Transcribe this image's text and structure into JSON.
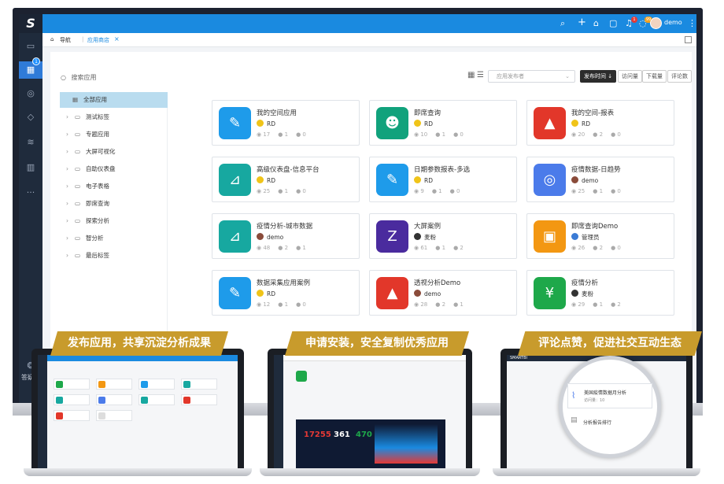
{
  "app": {
    "logo": "S",
    "nav_badge": "1"
  },
  "sidebar": {
    "items": [
      {
        "name": "monitor-icon",
        "glyph": "▭"
      },
      {
        "name": "apps-icon",
        "glyph": "▦"
      },
      {
        "name": "database-icon",
        "glyph": "◎"
      },
      {
        "name": "cube-icon",
        "glyph": "◇"
      },
      {
        "name": "layers-icon",
        "glyph": "≋"
      },
      {
        "name": "chart-icon",
        "glyph": "▥"
      },
      {
        "name": "more-icon",
        "glyph": "···"
      }
    ],
    "bottom_label": "答疑"
  },
  "topbar": {
    "user": "demo",
    "notif_badge": "1",
    "msg_badge": "99"
  },
  "breadcrumb": {
    "home": "导航",
    "current": "应用商店",
    "close": "×"
  },
  "search": {
    "placeholder": "搜索应用"
  },
  "filters": {
    "select_placeholder": "应用发布者",
    "sort_publish": "发布时间 ↓",
    "sort_visits": "访问量",
    "sort_downloads": "下载量",
    "sort_comments": "评论数"
  },
  "tree": {
    "items": [
      {
        "label": "全部应用",
        "selected": true
      },
      {
        "label": "测试标签"
      },
      {
        "label": "专题应用"
      },
      {
        "label": "大屏可视化"
      },
      {
        "label": "自助仪表盘"
      },
      {
        "label": "电子表格"
      },
      {
        "label": "即席查询"
      },
      {
        "label": "探索分析"
      },
      {
        "label": "智分析"
      },
      {
        "label": "最后标签"
      }
    ]
  },
  "cards": [
    {
      "title": "我的空间应用",
      "author": "RD",
      "views": "17",
      "users": "1",
      "comments": "0",
      "color": "#1e9bea",
      "glyph": "✎",
      "avatar": "#f0c419"
    },
    {
      "title": "即席查询",
      "author": "RD",
      "views": "10",
      "users": "1",
      "comments": "0",
      "color": "#11a27c",
      "glyph": "☻",
      "avatar": "#f0c419"
    },
    {
      "title": "我的空间-报表",
      "author": "RD",
      "views": "20",
      "users": "2",
      "comments": "0",
      "color": "#e2372a",
      "glyph": "▲",
      "avatar": "#f0c419"
    },
    {
      "title": "高级仪表盘-信息平台",
      "author": "RD",
      "views": "25",
      "users": "1",
      "comments": "0",
      "color": "#17a8a0",
      "glyph": "⊿",
      "avatar": "#f0c419"
    },
    {
      "title": "日期参数报表-多选",
      "author": "RD",
      "views": "9",
      "users": "1",
      "comments": "0",
      "color": "#1e9bea",
      "glyph": "✎",
      "avatar": "#f0c419"
    },
    {
      "title": "疫情数据-日趋势",
      "author": "demo",
      "views": "25",
      "users": "1",
      "comments": "0",
      "color": "#4b7bea",
      "glyph": "◎",
      "avatar": "#8a4b3a"
    },
    {
      "title": "疫情分析-城市数据",
      "author": "demo",
      "views": "48",
      "users": "2",
      "comments": "1",
      "color": "#17a8a0",
      "glyph": "⊿",
      "avatar": "#8a4b3a"
    },
    {
      "title": "大屏案例",
      "author": "麦粉",
      "views": "61",
      "users": "1",
      "comments": "2",
      "color": "#4a2b9e",
      "glyph": "Z",
      "avatar": "#333"
    },
    {
      "title": "即席查询Demo",
      "author": "管理员",
      "views": "26",
      "users": "2",
      "comments": "0",
      "color": "#f39712",
      "glyph": "▣",
      "avatar": "#3a7bd5"
    },
    {
      "title": "数据采集应用案例",
      "author": "RD",
      "views": "12",
      "users": "1",
      "comments": "0",
      "color": "#1e9bea",
      "glyph": "✎",
      "avatar": "#f0c419"
    },
    {
      "title": "透视分析Demo",
      "author": "demo",
      "views": "28",
      "users": "2",
      "comments": "1",
      "color": "#e2372a",
      "glyph": "▲",
      "avatar": "#8a4b3a"
    },
    {
      "title": "疫情分析",
      "author": "麦粉",
      "views": "29",
      "users": "1",
      "comments": "2",
      "color": "#1ea84a",
      "glyph": "¥",
      "avatar": "#333"
    }
  ],
  "ribbons": [
    "发布应用，共享沉淀分析成果",
    "申请安装，安全复制优秀应用",
    "评论点赞，促进社交互动生态"
  ],
  "mini": {
    "laptop2_numbers": [
      "17255",
      "361",
      "470"
    ],
    "laptop3_logo": "SMARTBI",
    "magnifier_card1": "美国疫情数据月分析",
    "magnifier_card1_sub": "访问量：10",
    "magnifier_card2": "分析报告排行"
  },
  "colors": {
    "topbar": "#1a8ae0",
    "sidebar": "#1f2b3c",
    "ribbon": "#c89b2c"
  }
}
